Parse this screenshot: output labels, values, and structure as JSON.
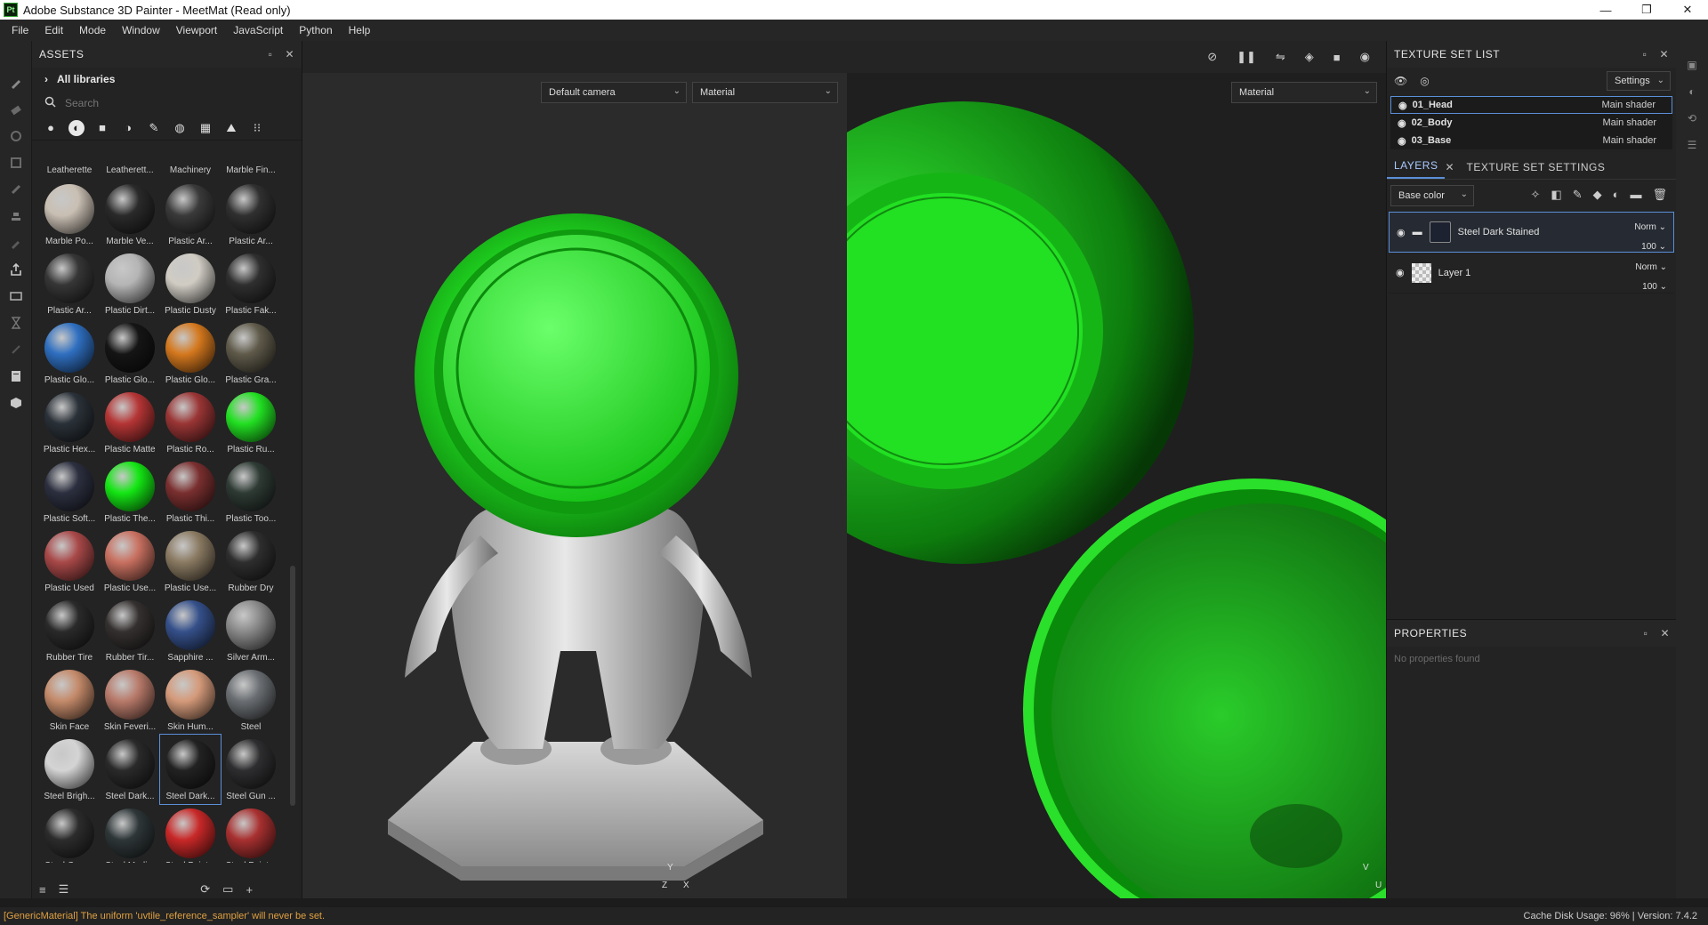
{
  "window": {
    "app_icon": "Pt",
    "title": "Adobe Substance 3D Painter - MeetMat (Read only)",
    "minimize": "—",
    "restore": "❐",
    "close": "✕"
  },
  "menu": [
    "File",
    "Edit",
    "Mode",
    "Window",
    "Viewport",
    "JavaScript",
    "Python",
    "Help"
  ],
  "assets": {
    "title": "ASSETS",
    "library": "All libraries",
    "search_placeholder": "Search",
    "top_row_labels": [
      "Leatherette",
      "Leatherett...",
      "Machinery",
      "Marble Fin..."
    ],
    "materials": [
      {
        "label": "Marble Po...",
        "color": "#c9bfb3"
      },
      {
        "label": "Marble Ve...",
        "color": "#2a2a2a"
      },
      {
        "label": "Plastic Ar...",
        "color": "#3a3a3a"
      },
      {
        "label": "Plastic Ar...",
        "color": "#303030"
      },
      {
        "label": "Plastic Ar...",
        "color": "#363636"
      },
      {
        "label": "Plastic Dirt...",
        "color": "#b5b5b5"
      },
      {
        "label": "Plastic Dusty",
        "color": "#d0ccc4"
      },
      {
        "label": "Plastic Fak...",
        "color": "#2f2f2f"
      },
      {
        "label": "Plastic Glo...",
        "color": "#2f6fc0"
      },
      {
        "label": "Plastic Glo...",
        "color": "#151515"
      },
      {
        "label": "Plastic Glo...",
        "color": "#d4781e"
      },
      {
        "label": "Plastic Gra...",
        "color": "#5f5a4a"
      },
      {
        "label": "Plastic Hex...",
        "color": "#2a3138"
      },
      {
        "label": "Plastic Matte",
        "color": "#b53535"
      },
      {
        "label": "Plastic Ro...",
        "color": "#9a3535"
      },
      {
        "label": "Plastic Ru...",
        "color": "#22e022"
      },
      {
        "label": "Plastic Soft...",
        "color": "#2c2f3f"
      },
      {
        "label": "Plastic The...",
        "color": "#14e614"
      },
      {
        "label": "Plastic Thi...",
        "color": "#7a2f2f"
      },
      {
        "label": "Plastic Too...",
        "color": "#2e3a34"
      },
      {
        "label": "Plastic Used",
        "color": "#a84848"
      },
      {
        "label": "Plastic Use...",
        "color": "#c87060"
      },
      {
        "label": "Plastic Use...",
        "color": "#8a7a62"
      },
      {
        "label": "Rubber Dry",
        "color": "#2e2e2e"
      },
      {
        "label": "Rubber Tire",
        "color": "#2a2a2a"
      },
      {
        "label": "Rubber Tir...",
        "color": "#353030"
      },
      {
        "label": "Sapphire ...",
        "color": "#35508a"
      },
      {
        "label": "Silver Arm...",
        "color": "#8a8a8a"
      },
      {
        "label": "Skin Face",
        "color": "#c48a6a"
      },
      {
        "label": "Skin Feveri...",
        "color": "#b87a6a"
      },
      {
        "label": "Skin Hum...",
        "color": "#d49a7a"
      },
      {
        "label": "Steel",
        "color": "#6a6e72"
      },
      {
        "label": "Steel Brigh...",
        "color": "#d4d4d4"
      },
      {
        "label": "Steel Dark...",
        "color": "#2a2a2a"
      },
      {
        "label": "Steel Dark...",
        "color": "#222222"
      },
      {
        "label": "Steel Gun ...",
        "color": "#2e2e30"
      },
      {
        "label": "Steel Gun ...",
        "color": "#2c2c2c"
      },
      {
        "label": "Steel Medi...",
        "color": "#2e3638"
      },
      {
        "label": "Steel Paint...",
        "color": "#c82828"
      },
      {
        "label": "Steel Paint...",
        "color": "#a83030"
      }
    ],
    "selected_material_index": 34
  },
  "viewport": {
    "camera": "Default camera",
    "mode_3d": "Material",
    "mode_2d": "Material",
    "axis_3d": {
      "y": "Y",
      "z": "Z",
      "x": "X"
    },
    "axis_2d": {
      "v": "V",
      "u": "U"
    }
  },
  "texture_set_list": {
    "title": "TEXTURE SET LIST",
    "settings": "Settings",
    "sets": [
      {
        "name": "01_Head",
        "shader": "Main shader"
      },
      {
        "name": "02_Body",
        "shader": "Main shader"
      },
      {
        "name": "03_Base",
        "shader": "Main shader"
      }
    ]
  },
  "layers": {
    "tab_layers": "LAYERS",
    "tab_settings": "TEXTURE SET SETTINGS",
    "channel": "Base color",
    "items": [
      {
        "name": "Steel Dark Stained",
        "blend": "Norm",
        "opacity": "100"
      },
      {
        "name": "Layer 1",
        "blend": "Norm",
        "opacity": "100"
      }
    ]
  },
  "properties": {
    "title": "PROPERTIES",
    "empty": "No properties found"
  },
  "status": {
    "message": "[GenericMaterial] The uniform 'uvtile_reference_sampler' will never be set.",
    "right": "Cache Disk Usage:   96% | Version: 7.4.2"
  },
  "colors": {
    "accent": "#5b8fd8",
    "mesh_green": "#22e022",
    "warning": "#e0a040"
  }
}
